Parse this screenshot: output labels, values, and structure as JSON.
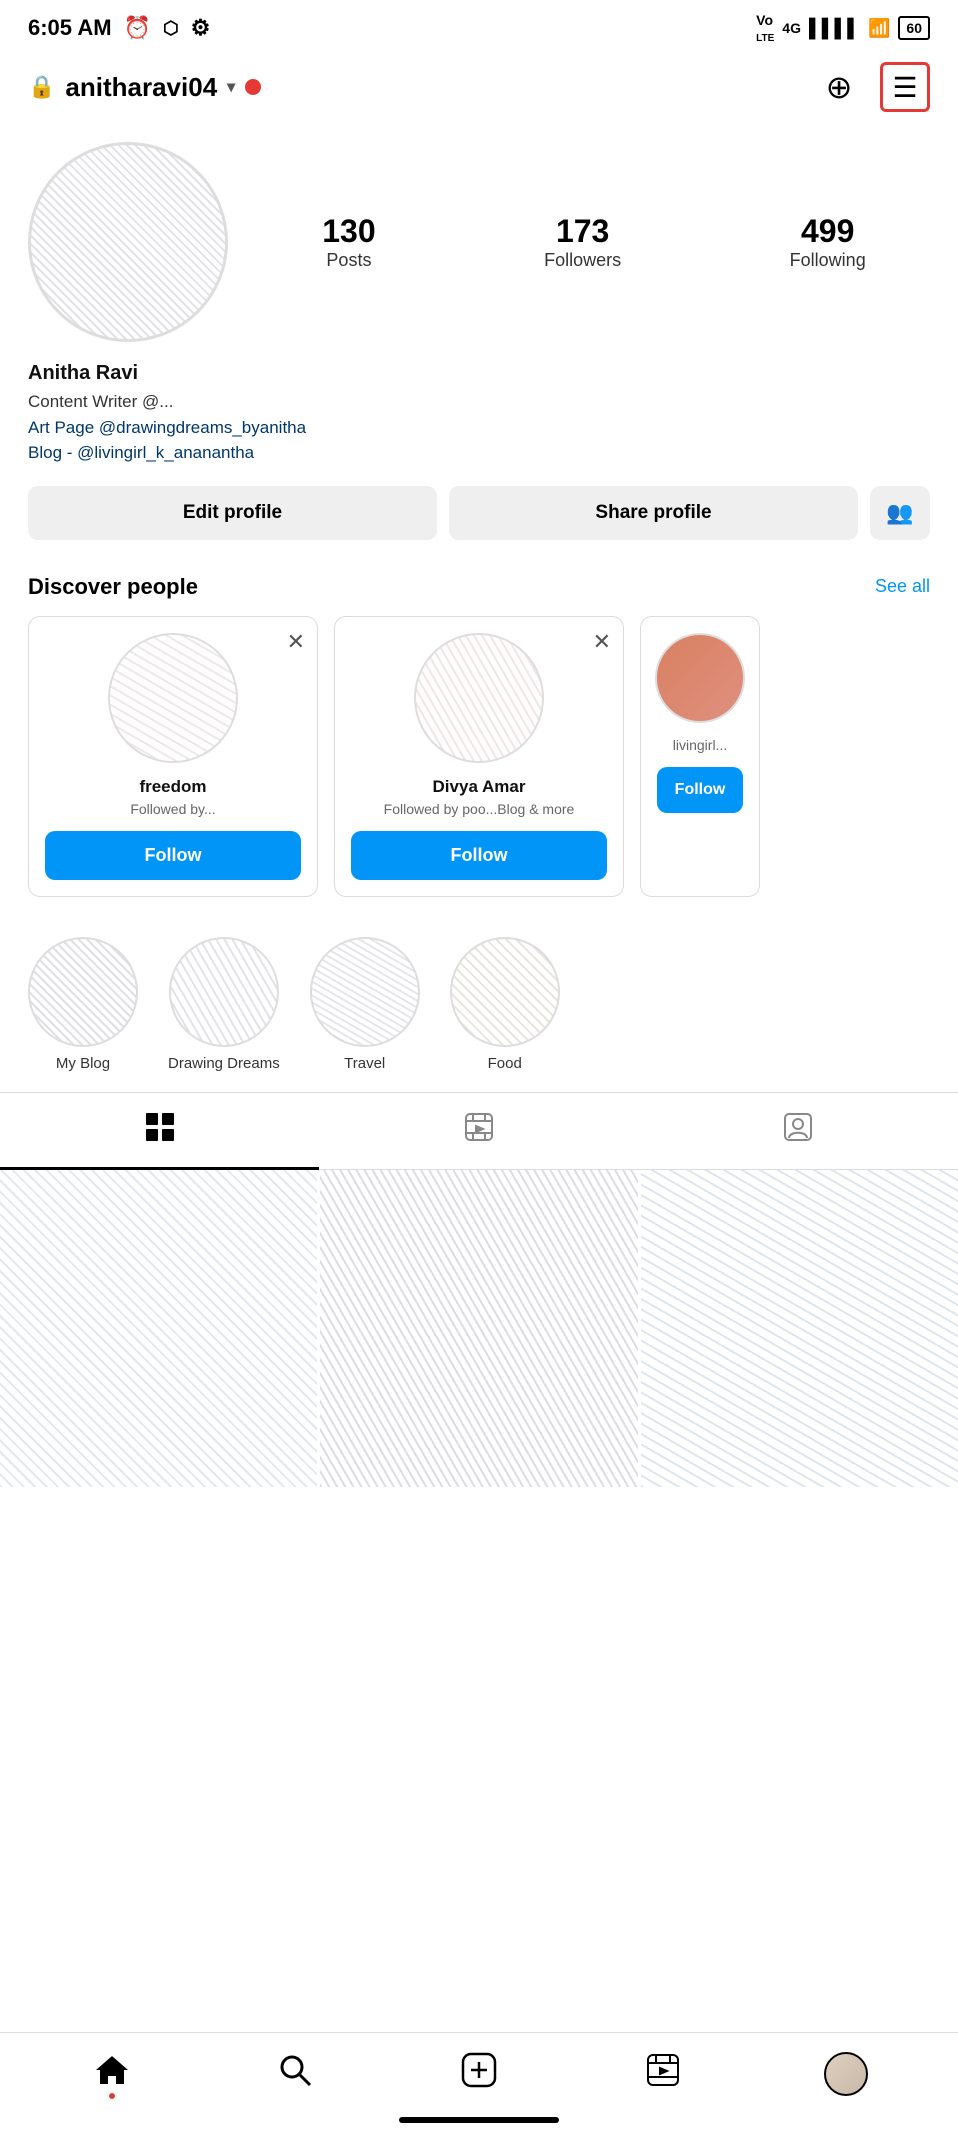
{
  "statusBar": {
    "time": "6:05 AM",
    "batteryLevel": "60"
  },
  "topNav": {
    "username": "anitharavi04",
    "addIcon": "⊕",
    "menuIcon": "☰"
  },
  "profile": {
    "name": "Anitha Ravi",
    "bioLine1": "Content Writer @...",
    "bioLine2": "Art Page @drawingdreams_byanitha",
    "bioLine3": "Blog - @livingirl_k_ananantha",
    "stats": {
      "posts": "130",
      "postsLabel": "Posts",
      "followers": "173",
      "followersLabel": "Followers",
      "following": "499",
      "followingLabel": "Following"
    }
  },
  "actionButtons": {
    "editProfile": "Edit profile",
    "shareProfile": "Share profile",
    "addFriendIcon": "👥"
  },
  "discoverPeople": {
    "title": "Discover people",
    "seeAll": "See all",
    "cards": [
      {
        "name": "freedom",
        "sub": "Followed by...",
        "followLabel": "Follow"
      },
      {
        "name": "Divya Amar",
        "sub": "Followed by poo...Blog &...",
        "followLabel": "Follow"
      },
      {
        "name": "",
        "sub": "livingirl...",
        "followLabel": "Follow"
      }
    ]
  },
  "highlights": {
    "items": [
      {
        "label": "My Blog"
      },
      {
        "label": "Drawing Dreams"
      },
      {
        "label": "Travel"
      },
      {
        "label": "Food"
      }
    ]
  },
  "tabs": {
    "grid": "⊞",
    "reels": "▶",
    "tagged": "👤"
  },
  "bottomNav": {
    "home": "⌂",
    "search": "🔍",
    "add": "⊕",
    "reels": "▶",
    "profile": ""
  }
}
